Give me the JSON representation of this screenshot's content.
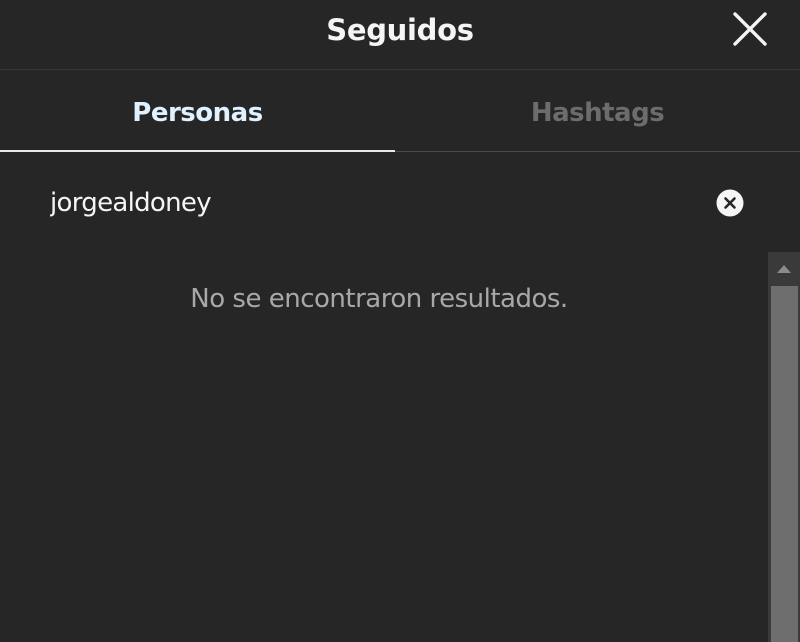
{
  "dialog": {
    "title": "Seguidos",
    "close_icon": "close-icon"
  },
  "tabs": [
    {
      "label": "Personas",
      "active": true
    },
    {
      "label": "Hashtags",
      "active": false
    }
  ],
  "search": {
    "value": "jorgealdoney",
    "clear_icon": "clear-circle-icon"
  },
  "results": {
    "empty_message": "No se encontraron resultados."
  },
  "colors": {
    "background": "#262626",
    "active_tab_text": "#e0f1ff",
    "inactive_tab_text": "#6c6c6c",
    "muted_text": "#a8a8a8",
    "scrollbar_track": "#3a3a3a",
    "scrollbar_thumb": "#6e6e6e"
  }
}
